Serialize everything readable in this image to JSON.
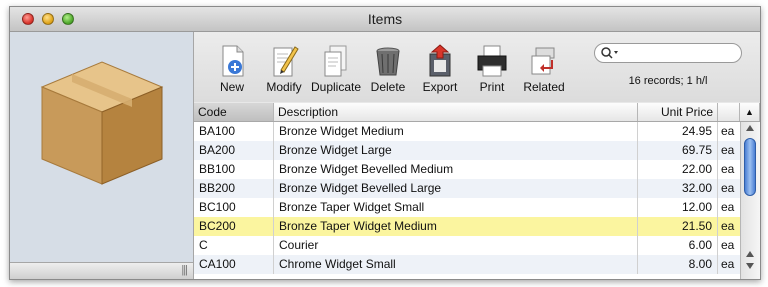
{
  "window": {
    "title": "Items"
  },
  "toolbar": {
    "new_label": "New",
    "modify_label": "Modify",
    "duplicate_label": "Duplicate",
    "delete_label": "Delete",
    "export_label": "Export",
    "print_label": "Print",
    "related_label": "Related"
  },
  "search": {
    "status": "16 records; 1 h/l"
  },
  "table": {
    "headers": {
      "code": "Code",
      "description": "Description",
      "unit_price": "Unit Price",
      "unit": "",
      "sort": "▲"
    },
    "rows": [
      {
        "code": "BA100",
        "description": "Bronze Widget Medium",
        "price": "24.95",
        "unit": "ea"
      },
      {
        "code": "BA200",
        "description": "Bronze Widget Large",
        "price": "69.75",
        "unit": "ea"
      },
      {
        "code": "BB100",
        "description": "Bronze Widget Bevelled Medium",
        "price": "22.00",
        "unit": "ea"
      },
      {
        "code": "BB200",
        "description": "Bronze Widget Bevelled Large",
        "price": "32.00",
        "unit": "ea"
      },
      {
        "code": "BC100",
        "description": "Bronze Taper Widget Small",
        "price": "12.00",
        "unit": "ea"
      },
      {
        "code": "BC200",
        "description": "Bronze Taper Widget Medium",
        "price": "21.50",
        "unit": "ea"
      },
      {
        "code": "C",
        "description": "Courier",
        "price": "6.00",
        "unit": "ea"
      },
      {
        "code": "CA100",
        "description": "Chrome Widget Small",
        "price": "8.00",
        "unit": "ea"
      }
    ],
    "highlighted_row": 5
  },
  "colors": {
    "highlight": "#fbf59f",
    "alt_row": "#eef2f8",
    "sidebar": "#d6dde6",
    "scroll_thumb": "#4b7fd4"
  },
  "icons": [
    "box-icon",
    "new-icon",
    "modify-icon",
    "duplicate-icon",
    "delete-icon",
    "export-icon",
    "print-icon",
    "related-icon",
    "search-icon"
  ]
}
